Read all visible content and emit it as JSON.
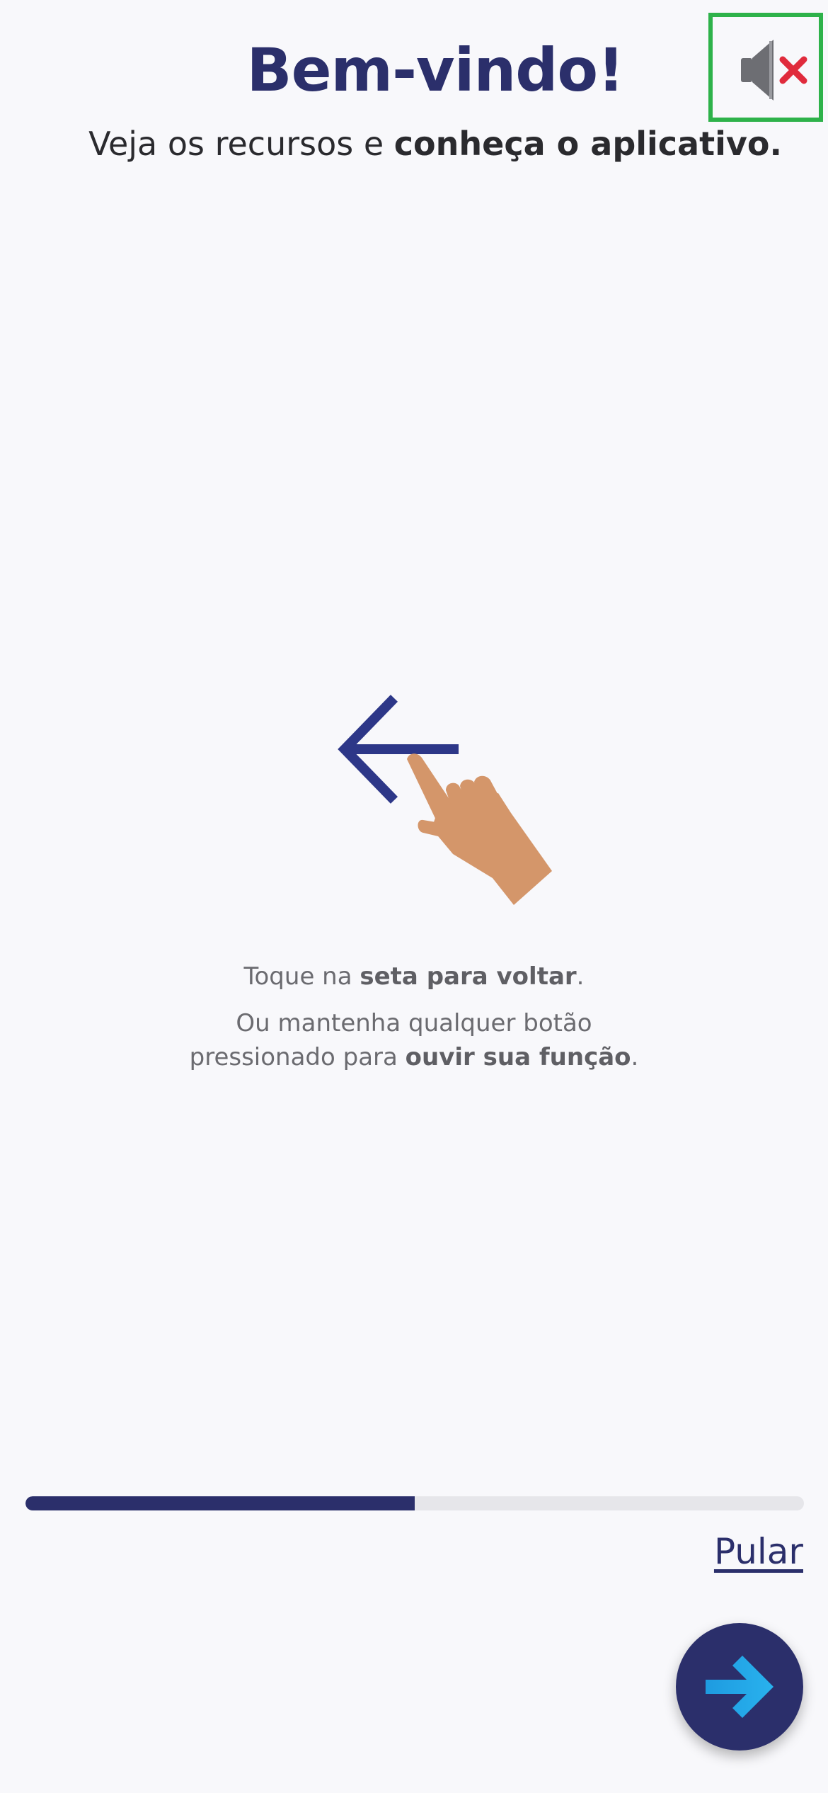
{
  "header": {
    "title": "Bem-vindo!",
    "subtitle_prefix": "Veja os recursos e ",
    "subtitle_bold": "conheça o aplicativo."
  },
  "mute_button": {
    "icon": "speaker-muted-icon"
  },
  "illustration": {
    "icon_arrow": "arrow-left-icon",
    "icon_hand": "tap-hand-icon"
  },
  "instructions": {
    "line1_prefix": "Toque na ",
    "line1_bold": "seta para voltar",
    "line1_suffix": ".",
    "line2_text": "Ou mantenha qualquer botão",
    "line3_prefix": "pressionado para ",
    "line3_bold": "ouvir sua função",
    "line3_suffix": "."
  },
  "progress": {
    "value": 0.5
  },
  "skip_label": "Pular",
  "next_button": {
    "icon": "arrow-right-icon"
  },
  "colors": {
    "primary": "#2b2f6b",
    "accent_arrow": "#1e9be0",
    "mute_border": "#2eb24a",
    "mute_x": "#e02b3c",
    "hand": "#d4966a",
    "background": "#f8f8fb"
  }
}
